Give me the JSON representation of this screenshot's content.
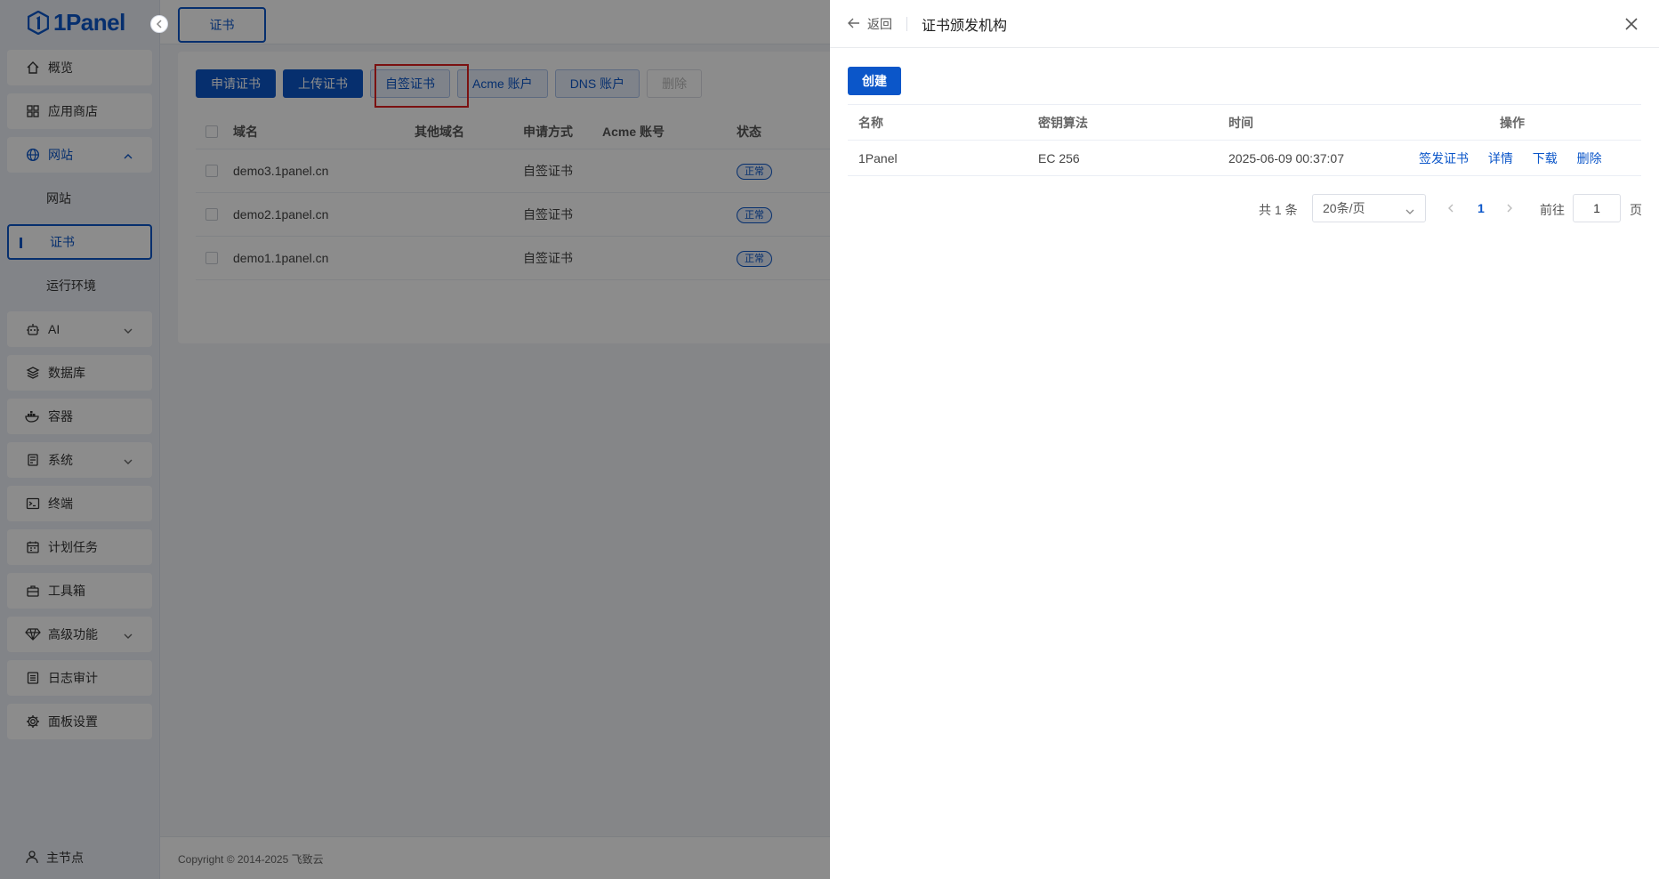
{
  "app": {
    "logo_text": "1Panel"
  },
  "sidebar": {
    "items": [
      {
        "label": "概览",
        "icon": "home-icon"
      },
      {
        "label": "应用商店",
        "icon": "grid-icon"
      },
      {
        "label": "网站",
        "icon": "globe-icon",
        "expanded": true,
        "children": [
          {
            "label": "网站"
          },
          {
            "label": "证书",
            "active": true
          },
          {
            "label": "运行环境"
          }
        ]
      },
      {
        "label": "AI",
        "icon": "robot-icon"
      },
      {
        "label": "数据库",
        "icon": "layers-icon"
      },
      {
        "label": "容器",
        "icon": "docker-icon"
      },
      {
        "label": "系统",
        "icon": "server-icon"
      },
      {
        "label": "终端",
        "icon": "terminal-icon"
      },
      {
        "label": "计划任务",
        "icon": "calendar-icon"
      },
      {
        "label": "工具箱",
        "icon": "toolbox-icon"
      },
      {
        "label": "高级功能",
        "icon": "diamond-icon"
      },
      {
        "label": "日志审计",
        "icon": "log-icon"
      },
      {
        "label": "面板设置",
        "icon": "gear-icon"
      }
    ],
    "footer": {
      "label": "主节点",
      "icon": "user-icon"
    }
  },
  "main": {
    "tab": "证书",
    "toolbar": {
      "apply": "申请证书",
      "upload": "上传证书",
      "self_signed": "自签证书",
      "acme": "Acme 账户",
      "dns": "DNS 账户",
      "delete": "删除"
    },
    "table": {
      "headers": {
        "domain": "域名",
        "other": "其他域名",
        "method": "申请方式",
        "acme": "Acme 账号",
        "status": "状态"
      },
      "rows": [
        {
          "domain": "demo3.1panel.cn",
          "method": "自签证书",
          "status": "正常"
        },
        {
          "domain": "demo2.1panel.cn",
          "method": "自签证书",
          "status": "正常"
        },
        {
          "domain": "demo1.1panel.cn",
          "method": "自签证书",
          "status": "正常"
        }
      ]
    },
    "footer": "Copyright © 2014-2025 飞致云"
  },
  "drawer": {
    "back": "返回",
    "title": "证书颁发机构",
    "create": "创建",
    "headers": {
      "name": "名称",
      "algo": "密钥算法",
      "time": "时间",
      "ops": "操作"
    },
    "rows": [
      {
        "name": "1Panel",
        "algo": "EC 256",
        "time": "2025-06-09 00:37:07",
        "ops": {
          "issue": "签发证书",
          "detail": "详情",
          "download": "下载",
          "delete": "删除"
        }
      }
    ],
    "pager": {
      "total": "共 1 条",
      "size": "20条/页",
      "page": "1",
      "goto": "前往",
      "goto_value": "1",
      "suffix": "页"
    }
  },
  "colors": {
    "accent": "#0b56c9",
    "highlight": "#e02020"
  }
}
